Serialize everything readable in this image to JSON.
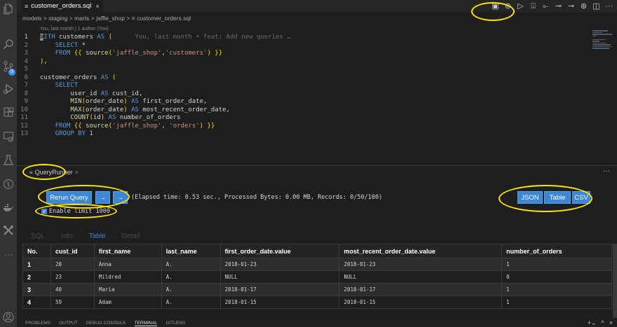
{
  "editor": {
    "tab_title": "customer_orders.sql",
    "tab_close": "×",
    "breadcrumb": "models > staging > marts > jaffle_shop > ≡ customer_orders.sql",
    "blame": "You, last month | 1 author (You)",
    "ghost_text": "You, last month • feat: Add new queries …",
    "line_numbers": [
      "1",
      "2",
      "3",
      "4",
      "5",
      "6",
      "7",
      "8",
      "9",
      "10",
      "11",
      "12",
      "13"
    ]
  },
  "panel": {
    "tab_title": "QueryRunner",
    "tab_close": "×",
    "more": "···",
    "rerun_label": "Rerun Query",
    "prev_label": "→",
    "next_label": "→",
    "elapsed": "(Elapsed time: 0.53 sec., Processed Bytes: 0.00 MB, Records: 0/50/100)",
    "limit_label": "Enable limit 1000",
    "limit_checked": true,
    "export_buttons": [
      "JSON",
      "Table",
      "CSV"
    ],
    "subtabs": [
      "SQL",
      "Info",
      "Table",
      "Detail"
    ],
    "active_subtab": "Table"
  },
  "table": {
    "headers": [
      "No.",
      "cust_id",
      "first_name",
      "last_name",
      "first_order_date.value",
      "most_recent_order_date.value",
      "number_of_orders"
    ],
    "rows": [
      [
        "1",
        "20",
        "Anna",
        "A.",
        "2018-01-23",
        "2018-01-23",
        "1"
      ],
      [
        "2",
        "23",
        "Mildred",
        "A.",
        "NULL",
        "NULL",
        "0"
      ],
      [
        "3",
        "40",
        "Maria",
        "A.",
        "2018-01-17",
        "2018-01-17",
        "1"
      ],
      [
        "4",
        "59",
        "Adam",
        "A.",
        "2018-01-15",
        "2018-01-15",
        "1"
      ]
    ]
  },
  "bottom_tabs": [
    "PROBLEMS",
    "OUTPUT",
    "DEBUG CONSOLE",
    "TERMINAL",
    "GITLENS"
  ],
  "bottom_active": "TERMINAL",
  "badge_count": "9",
  "colors": {
    "accent": "#3c86d6",
    "highlight": "#ffe600",
    "background": "#1e1e1e"
  }
}
